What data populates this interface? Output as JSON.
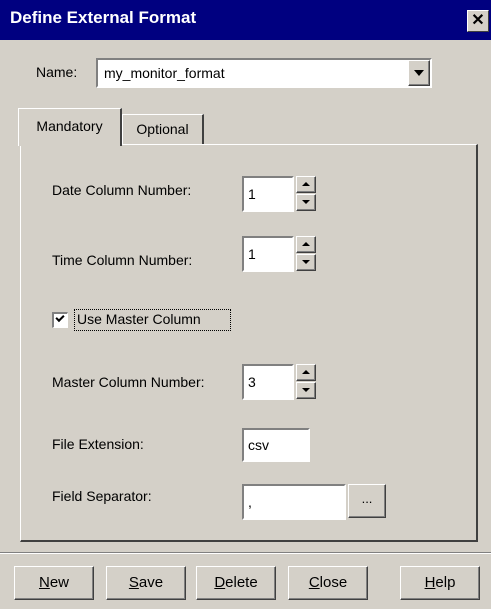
{
  "window": {
    "title": "Define External  Format",
    "close_glyph": "✕"
  },
  "name_field": {
    "label": "Name:",
    "value": "my_monitor_format"
  },
  "tabs": [
    {
      "label": "Mandatory"
    },
    {
      "label": "Optional"
    }
  ],
  "fields": {
    "date_column": {
      "label": "Date Column Number:",
      "value": "1"
    },
    "time_column": {
      "label": "Time Column Number:",
      "value": "1"
    },
    "use_master": {
      "label": "Use Master Column",
      "checked": true
    },
    "master_column": {
      "label": "Master Column Number:",
      "value": "3"
    },
    "file_extension": {
      "label": "File Extension:",
      "value": "csv"
    },
    "field_separator": {
      "label": "Field Separator:",
      "value": ",",
      "browse_label": "..."
    }
  },
  "buttons": {
    "new": {
      "accel": "N",
      "rest": "ew"
    },
    "save": {
      "accel": "S",
      "rest": "ave"
    },
    "delete": {
      "accel": "D",
      "rest": "elete"
    },
    "close": {
      "accel": "C",
      "rest": "lose"
    },
    "help": {
      "accel": "H",
      "rest": "elp"
    }
  },
  "colors": {
    "titlebar": "#000080",
    "face": "#d4d0c8"
  },
  "icons": {
    "close": "close-icon",
    "dropdown": "chevron-down-icon",
    "spin_up": "spin-up-icon",
    "spin_down": "spin-down-icon",
    "check": "check-icon"
  }
}
